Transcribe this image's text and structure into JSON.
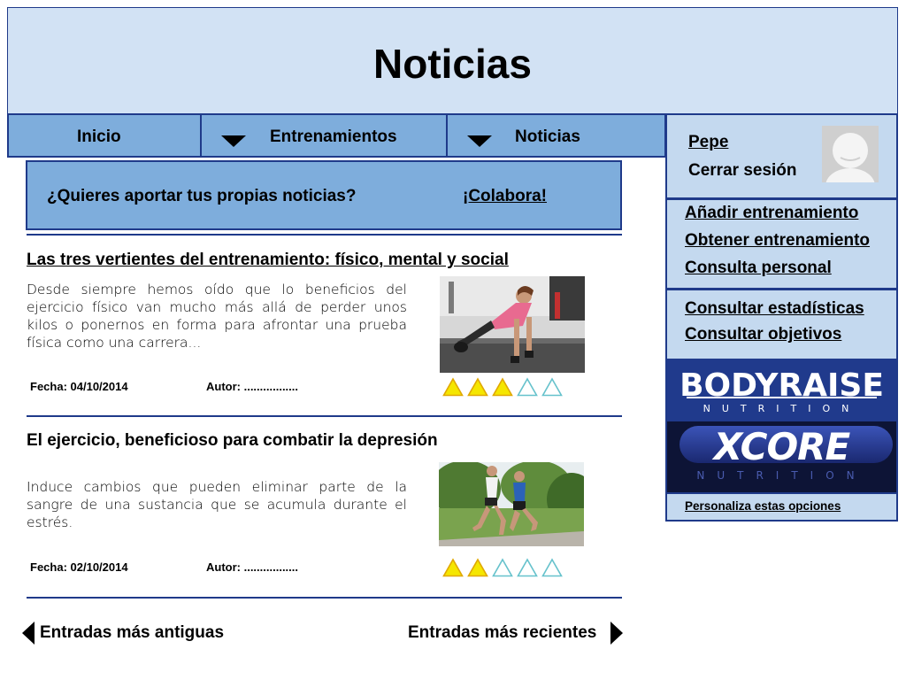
{
  "header": {
    "title": "Noticias"
  },
  "nav": {
    "items": [
      {
        "label": "Inicio"
      },
      {
        "label": "Entrenamientos"
      },
      {
        "label": "Noticias"
      }
    ]
  },
  "user": {
    "name": "Pepe",
    "logout_label": "Cerrar sesión"
  },
  "sidebar": {
    "menu1": [
      {
        "label": "Añadir entrenamiento"
      },
      {
        "label": "Obtener entrenamiento"
      },
      {
        "label": "Consulta personal"
      }
    ],
    "menu2": [
      {
        "label": "Consultar estadísticas"
      },
      {
        "label": "Consultar objetivos"
      }
    ],
    "banners": [
      {
        "brand": "BODYRAISE",
        "tagline": "NUTRITION"
      },
      {
        "brand": "XCORE",
        "tagline": "NUTRITION"
      }
    ],
    "customize_label": "Personaliza estas opciones"
  },
  "collab": {
    "question": "¿Quieres aportar tus propias noticias?",
    "link_label": "¡Colabora!"
  },
  "articles": [
    {
      "title": "Las tres vertientes del entrenamiento: físico, mental y social",
      "summary": "Desde siempre hemos oído que lo beneficios del ejercicio físico van mucho más allá de perder unos kilos o ponernos en forma para afrontar una prueba física como una carrera...",
      "date_label": "Fecha: 04/10/2014",
      "author_label": "Autor: .................",
      "rating": 3,
      "rating_max": 5
    },
    {
      "title": "El ejercicio, beneficioso para combatir la depresión",
      "summary": "Induce cambios que pueden eliminar parte de la sangre de una sustancia que se acumula durante el estrés.",
      "date_label": "Fecha: 02/10/2014",
      "author_label": "Autor: .................",
      "rating": 2,
      "rating_max": 5
    }
  ],
  "pagination": {
    "older_label": "Entradas más antiguas",
    "newer_label": "Entradas más recientes"
  },
  "colors": {
    "header_bg": "#d2e2f4",
    "nav_bg": "#7eaddc",
    "sidebar_bg": "#c4d9ef",
    "border": "#1f3a8a",
    "star_filled": "#f5e600",
    "star_empty": "#66c2cc"
  },
  "icons": {
    "avatar": "user-avatar-icon",
    "nav_dropdown": "chevron-down-icon",
    "rating": "triangle-star-icon",
    "pager_prev": "arrow-left-icon",
    "pager_next": "arrow-right-icon"
  }
}
